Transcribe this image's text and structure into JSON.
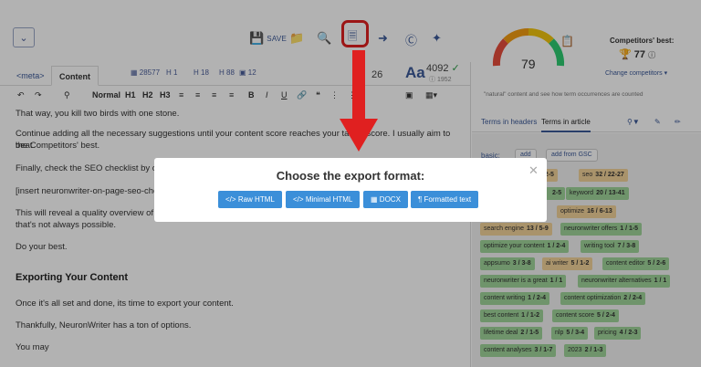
{
  "toolbar": {
    "collapse_icon": "chevron-down-icon",
    "save_label": "SAVE"
  },
  "tabs": [
    {
      "label": "<meta>"
    },
    {
      "label": "Content"
    }
  ],
  "stats": {
    "chars": "28577",
    "h1": "1",
    "h2": "18",
    "h3": "88",
    "img": "12",
    "h_count": "26",
    "word_count": "4092",
    "word_target": "1952"
  },
  "format": {
    "normal": "Normal",
    "h1": "H1",
    "h2": "H2",
    "h3": "H3"
  },
  "content": [
    "That way, you kill two birds with one stone.",
    "Continue adding all the necessary suggestions until your content score reaches your target score. I usually aim to beat",
    "the Competitors' best.",
    "Finally, check the SEO checklist by click",
    "[insert neuronwriter-on-page-seo-che",
    "This will reveal a quality overview of a",
    "that's not always possible.",
    "Do your best.",
    "Once it's all set and done, its time to export your content.",
    "Thankfully, NeuronWriter has a ton of options.",
    "You may"
  ],
  "heading": "Exporting Your Content",
  "score": {
    "value": "79",
    "comp_title": "Competitors' best:",
    "comp_value": "77",
    "comp_link": "Change competitors"
  },
  "note": "\"natural\" content and see how term occurrences are counted",
  "terms_tabs": [
    {
      "label": "Terms in headers"
    },
    {
      "label": "Terms in article"
    }
  ],
  "basic_label": "basic:",
  "add_label": "add",
  "add_gsc_label": "add from GSC",
  "keywords": [
    {
      "term": "seo",
      "count": "32 / 22-27"
    },
    {
      "term": "keyword",
      "count": "20 / 13-41"
    },
    {
      "term": "optimize",
      "count": "16 / 6-13"
    },
    {
      "term": "search engine",
      "count": "13 / 5-9"
    },
    {
      "term": "neuronwriter offers",
      "count": "1 / 1-5"
    },
    {
      "term": "optimize your content",
      "count": "1 / 2-4"
    },
    {
      "term": "writing tool",
      "count": "7 / 3-8"
    },
    {
      "term": "appsumo",
      "count": "3 / 3-8"
    },
    {
      "term": "ai writer",
      "count": "5 / 1-2"
    },
    {
      "term": "content editor",
      "count": "5 / 2-6"
    },
    {
      "term": "neuronwriter is a great",
      "count": "1 / 1"
    },
    {
      "term": "neuronwriter alternatives",
      "count": "1 / 1"
    },
    {
      "term": "content writing",
      "count": "1 / 2-4"
    },
    {
      "term": "content optimization",
      "count": "2 / 2-4"
    },
    {
      "term": "best content",
      "count": "1 / 1-2"
    },
    {
      "term": "content score",
      "count": "5 / 2-4"
    },
    {
      "term": "lifetime deal",
      "count": "2 / 1-5"
    },
    {
      "term": "nlp",
      "count": "5 / 3-4"
    },
    {
      "term": "pricing",
      "count": "4 / 2-3"
    },
    {
      "term": "content analyses",
      "count": "3 / 1-7"
    },
    {
      "term": "2023",
      "count": "2 / 1-3"
    }
  ],
  "partial_counts": [
    "4 / 2-5",
    "2-5"
  ],
  "modal": {
    "title": "Choose the export format:",
    "buttons": [
      "Raw HTML",
      "Minimal HTML",
      "DOCX",
      "Formatted text"
    ]
  },
  "colors": {
    "accent": "#3b5998",
    "button": "#3b8fd9",
    "highlight": "#e02020",
    "chip_green": "#9fd49a",
    "chip_yellow": "#f3d39a"
  }
}
